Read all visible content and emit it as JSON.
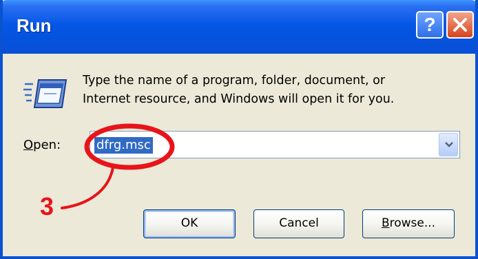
{
  "window": {
    "title": "Run",
    "help_glyph": "?",
    "icons": [
      "help-icon",
      "close-icon"
    ]
  },
  "content": {
    "icon": "run-program-icon",
    "description_line1": "Type the name of a program, folder, document, or",
    "description_line2": "Internet resource, and Windows will open it for you."
  },
  "open": {
    "label_accel": "O",
    "label_rest": "pen:",
    "value": "dfrg.msc",
    "dropdown_icon": "chevron-down-icon"
  },
  "annotation": {
    "number": "3",
    "color": "#e8141a"
  },
  "buttons": {
    "ok": "OK",
    "cancel": "Cancel",
    "browse_accel": "B",
    "browse_rest": "rowse..."
  },
  "colors": {
    "titlebar": "#0757e6",
    "dialog_bg": "#ece9d8",
    "selection": "#316ac5",
    "close_button": "#d8431c"
  }
}
